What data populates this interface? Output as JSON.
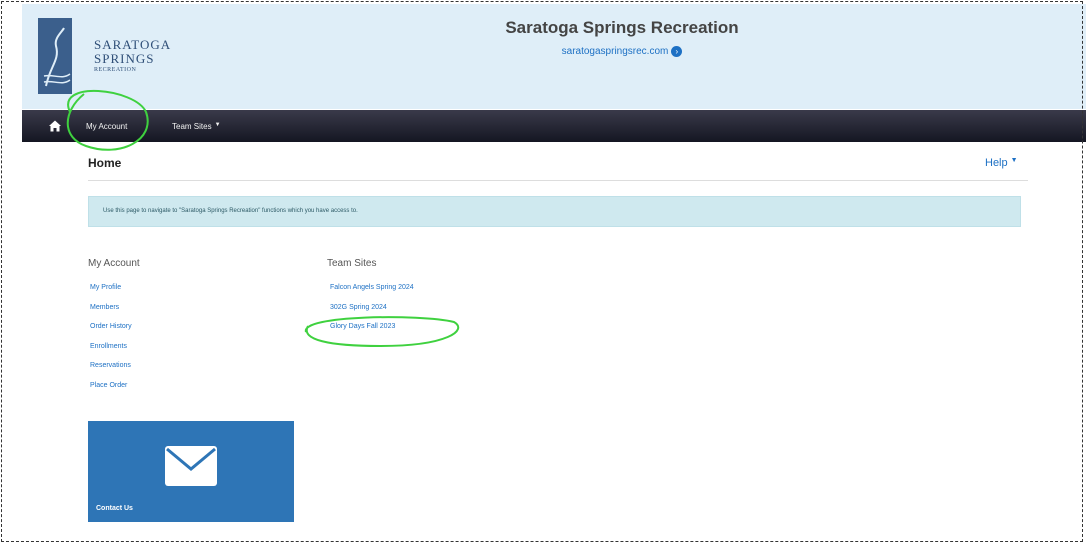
{
  "header": {
    "logo": {
      "line1": "SARATOGA",
      "line2": "SPRINGS",
      "line3": "RECREATION"
    },
    "title": "Saratoga Springs Recreation",
    "url": "saratogaspringsrec.com",
    "url_icon": "circle-arrow-right-icon"
  },
  "nav": {
    "home_icon": "home-icon",
    "items": [
      {
        "label": "My Account"
      },
      {
        "label": "Team Sites"
      }
    ]
  },
  "page": {
    "title": "Home",
    "help": "Help",
    "info": "Use this page to navigate to \"Saratoga Springs Recreation\" functions which you have access to."
  },
  "my_account": {
    "title": "My Account",
    "links": [
      "My Profile",
      "Members",
      "Order History",
      "Enrollments",
      "Reservations",
      "Place Order"
    ]
  },
  "team_sites": {
    "title": "Team Sites",
    "links": [
      "Falcon Angels Spring 2024",
      "302G Spring 2024",
      "Glory Days Fall 2023"
    ]
  },
  "contact": {
    "label": "Contact Us",
    "icon": "envelope-icon"
  },
  "colors": {
    "header_bg": "#dfeef8",
    "navbar": "#1f2130",
    "link": "#1d70c4",
    "info_bg": "#cfe9ef",
    "contact_bg": "#2e75b6",
    "annotation": "#3fd13f"
  }
}
